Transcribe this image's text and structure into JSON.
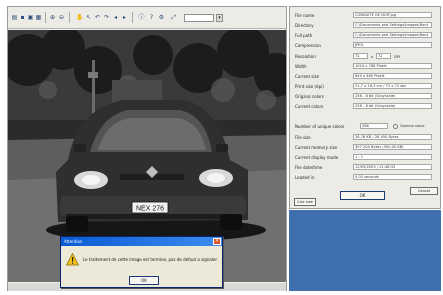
{
  "viewer": {
    "toolbar_icons": [
      "open-icon",
      "save-icon",
      "print-icon",
      "info-icon",
      "zoom-in-icon",
      "zoom-out-icon",
      "hand-icon",
      "pointer-icon",
      "rotate-left-icon",
      "rotate-right-icon",
      "prev-icon",
      "next-icon",
      "dropdown-icon"
    ],
    "plate_text": "NEX 276"
  },
  "alert": {
    "title": "Attention",
    "message": "Le traitement de cette image est termine, pas de defaut a signaler.",
    "ok_label": "OK"
  },
  "properties": {
    "rows": [
      {
        "label": "File name",
        "value": "CONDUITE DE NUIT.jpg"
      },
      {
        "label": "Directory",
        "value": "C:\\Documents and Settings\\Images\\Rout"
      },
      {
        "label": "Full path",
        "value": "C:\\Documents and Settings\\Images\\Rout"
      },
      {
        "label": "Compression",
        "value": "JPEG"
      },
      {
        "label": "Width",
        "value": "1024 x 768 Pixels"
      },
      {
        "label": "Current size",
        "value": "640 x 480 Pixels"
      },
      {
        "label": "Print size (dpi)",
        "value": "21,7 x 16,3 cm / 72 x 72 dpi"
      },
      {
        "label": "Original colors",
        "value": "256 - 8 bit (Grayscale)"
      },
      {
        "label": "Current colors",
        "value": "256 - 8 bit (Grayscale)"
      },
      {
        "label": "File size",
        "value": "28,76 KB / 28 450 Bytes"
      },
      {
        "label": "Current memory size",
        "value": "307 200 Bytes (300,00 KB)"
      },
      {
        "label": "Current display mode",
        "value": "1 : 1"
      },
      {
        "label": "File date/time",
        "value": "12/05/2003 / 21:48:32"
      },
      {
        "label": "Loaded in",
        "value": "0,05 seconds"
      }
    ],
    "resolution": {
      "label": "Resolution",
      "w": "72",
      "sep1": "x",
      "h": "72",
      "unit": "DPI"
    },
    "unique_colors": {
      "label": "Number of unique colors",
      "value": "256",
      "option": "Gamma value"
    },
    "calc_label": "Calc size",
    "ok_label": "OK",
    "cancel_label": "Cancel"
  },
  "colors": {
    "title_bar": "#0a5ad4",
    "desktop": "#3f6fae",
    "close_button": "#d8542c",
    "warning_icon": "#f2c21c"
  }
}
